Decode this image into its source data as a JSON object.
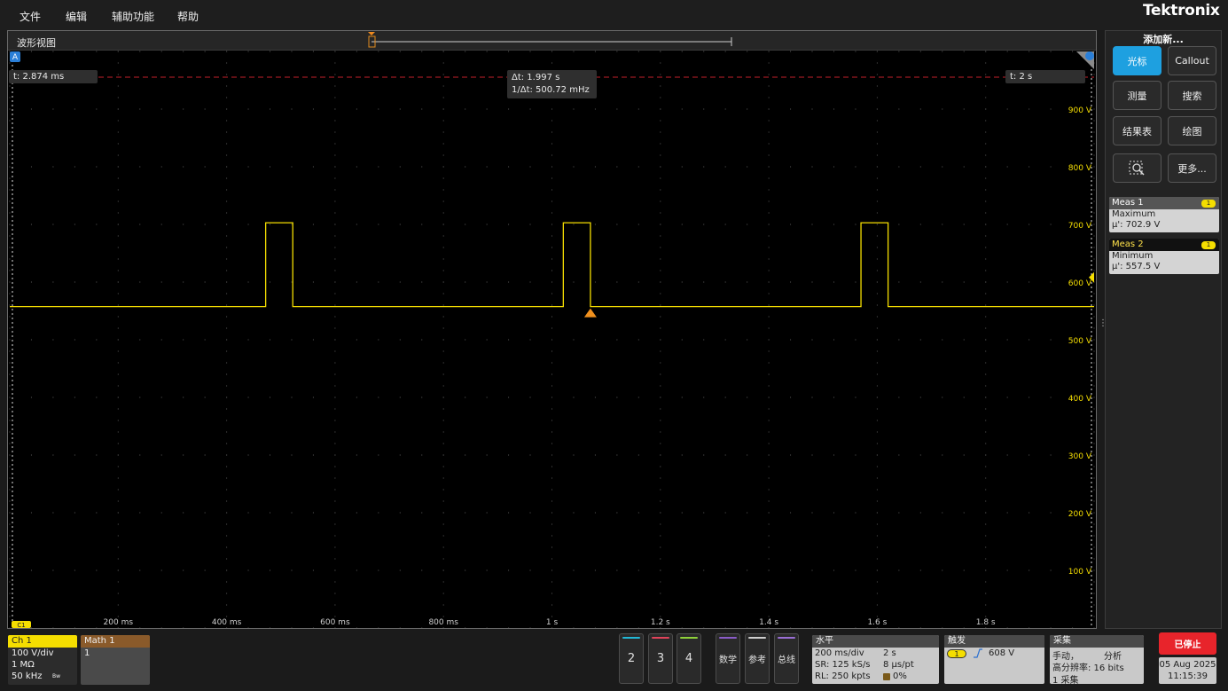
{
  "menu": {
    "items": [
      "文件",
      "编辑",
      "辅助功能",
      "帮助"
    ],
    "logo": "Tektronix"
  },
  "waveform_view": {
    "title": "波形视图",
    "cursor_a_label": "A",
    "cursor_b_label": "B",
    "cursor_left_readout": "t: 2.874 ms",
    "cursor_right_readout": "t: 2 s",
    "delta_t": "Δt: 1.997 s",
    "inv_delta_t": "1/Δt: 500.72 mHz",
    "channel_marker": "C1",
    "y_ticks": [
      "900 V",
      "800 V",
      "700 V",
      "600 V",
      "500 V",
      "400 V",
      "300 V",
      "200 V",
      "100 V"
    ],
    "x_ticks": [
      "200 ms",
      "400 ms",
      "600 ms",
      "800 ms",
      "1 s",
      "1.2 s",
      "1.4 s",
      "1.6 s",
      "1.8 s"
    ],
    "trace_color": "#f5de00",
    "pulses": [
      {
        "start_s": 0.472,
        "end_s": 0.522
      },
      {
        "start_s": 1.021,
        "end_s": 1.071
      },
      {
        "start_s": 1.57,
        "end_s": 1.62
      }
    ],
    "base_level_v": 557.5,
    "high_level_v": 702.9,
    "trigger_level_v": 608,
    "time_range_s": [
      0,
      2
    ],
    "volt_range_v": [
      0,
      1000
    ]
  },
  "right_panel": {
    "add_new": "添加新...",
    "buttons": {
      "cursor": "光标",
      "callout": "Callout",
      "measure": "测量",
      "search": "搜索",
      "results_table": "结果表",
      "plot": "绘图",
      "more": "更多..."
    },
    "meas1": {
      "title": "Meas 1",
      "badge": "1",
      "type": "Maximum",
      "value": "μ': 702.9 V"
    },
    "meas2": {
      "title": "Meas 2",
      "badge": "1",
      "type": "Minimum",
      "value": "μ': 557.5 V"
    }
  },
  "bottom": {
    "ch1": {
      "title": "Ch 1",
      "vdiv": "100 V/div",
      "impedance": "1 MΩ",
      "bandwidth": "50 kHz",
      "bw_icon": "Bw"
    },
    "math1": {
      "title": "Math 1",
      "value": "1"
    },
    "ch_buttons": [
      {
        "label": "2",
        "color": "#22b8d6"
      },
      {
        "label": "3",
        "color": "#e0435a"
      },
      {
        "label": "4",
        "color": "#8fd13a"
      }
    ],
    "util_buttons": [
      {
        "label": "数学",
        "color": "#8a5cc8"
      },
      {
        "label": "参考",
        "color": "#cfcfcf"
      },
      {
        "label": "总线",
        "color": "#9a6fd6"
      }
    ],
    "horizontal": {
      "title": "水平",
      "tdiv": "200 ms/div",
      "duration": "2 s",
      "sr": "SR: 125 kS/s",
      "pt": "8 μs/pt",
      "rl": "RL: 250 kpts",
      "pct": "0%"
    },
    "trigger": {
      "title": "触发",
      "source": "1",
      "level": "608 V"
    },
    "acquisition": {
      "title": "采集",
      "mode": "手动，",
      "analyze": "分析",
      "hires": "高分辨率: 16 bits",
      "count": "1 采集"
    },
    "stop_label": "已停止",
    "date": "05 Aug 2025",
    "time": "11:15:39"
  }
}
